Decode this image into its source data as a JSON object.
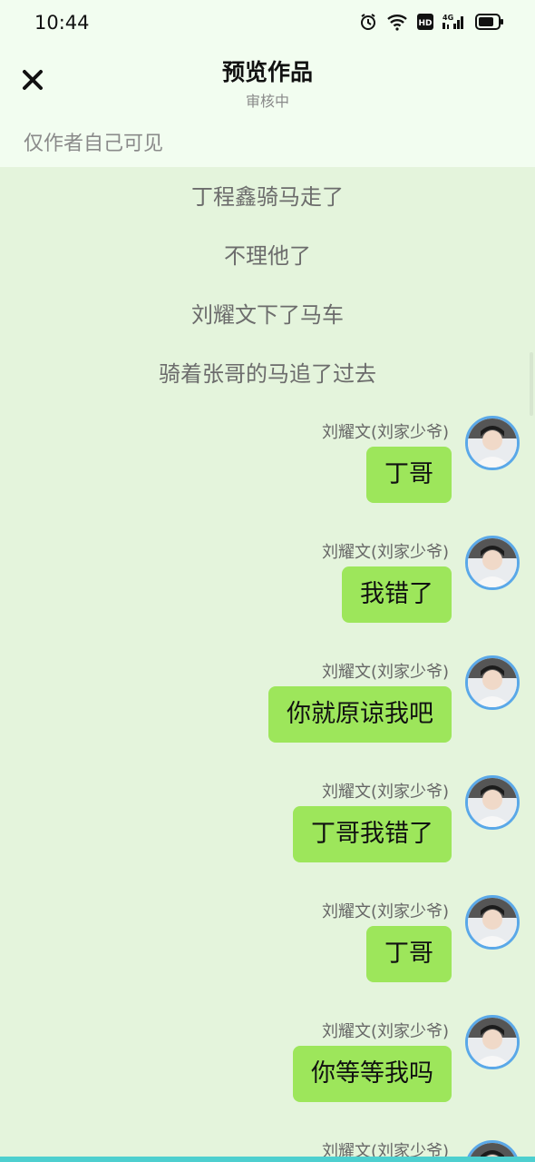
{
  "status_bar": {
    "time": "10:44",
    "icons": [
      "alarm-icon",
      "wifi-icon",
      "hd-icon",
      "signal-4g-icon",
      "battery-icon"
    ]
  },
  "header": {
    "close_icon": "close-icon",
    "title": "预览作品",
    "subtitle": "审核中",
    "visibility_note": "仅作者自己可见"
  },
  "narration": [
    "丁程鑫骑马走了",
    "不理他了",
    "刘耀文下了马车",
    "骑着张哥的马追了过去"
  ],
  "messages": [
    {
      "sender": "刘耀文(刘家少爷)",
      "text": "丁哥"
    },
    {
      "sender": "刘耀文(刘家少爷)",
      "text": "我错了"
    },
    {
      "sender": "刘耀文(刘家少爷)",
      "text": "你就原谅我吧"
    },
    {
      "sender": "刘耀文(刘家少爷)",
      "text": "丁哥我错了"
    },
    {
      "sender": "刘耀文(刘家少爷)",
      "text": "丁哥"
    },
    {
      "sender": "刘耀文(刘家少爷)",
      "text": "你等等我吗"
    },
    {
      "sender": "刘耀文(刘家少爷)",
      "text": ""
    }
  ],
  "colors": {
    "chat_background": "#e4f4dc",
    "header_background": "#f2fdf0",
    "bubble": "#9de65b",
    "avatar_border": "#5aa8e8"
  }
}
